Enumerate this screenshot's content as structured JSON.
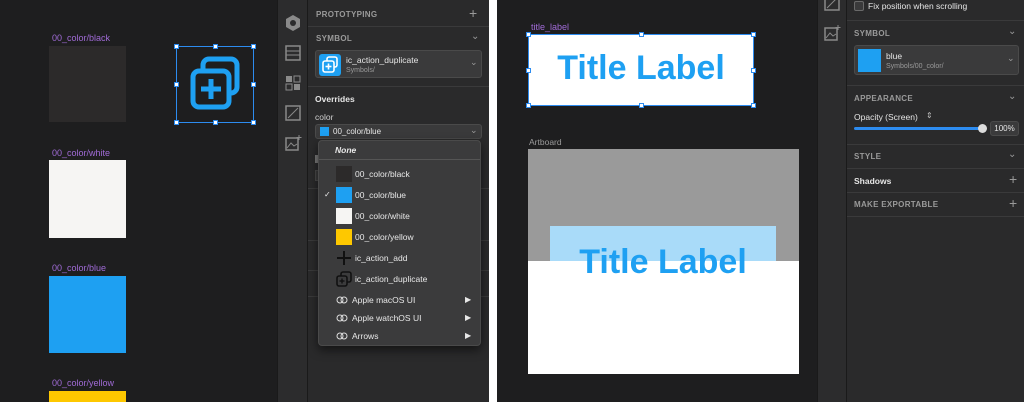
{
  "colors": {
    "blue": "#1ea0f2",
    "black": "#2c2a2a",
    "white": "#f6f5f3",
    "yellow": "#fec800",
    "selection": "#2d8cf0",
    "symbol_label": "#a06bd6"
  },
  "left_canvas": {
    "symbols": [
      {
        "label": "00_color/black"
      },
      {
        "label": "00_color/white"
      },
      {
        "label": "00_color/blue"
      },
      {
        "label": "00_color/yellow"
      }
    ],
    "icon_name": "duplicate-icon"
  },
  "inspector": {
    "prototyping": "PROTOTYPING",
    "symbol_header": "SYMBOL",
    "symbol_name": "ic_action_duplicate",
    "symbol_path": "Symbols/",
    "overrides": "Overrides",
    "color_label": "color",
    "color_value": "00_color/blue"
  },
  "dropdown": {
    "none": "None",
    "items": [
      {
        "label": "00_color/black",
        "swatch": "#2c2a2a",
        "checked": false
      },
      {
        "label": "00_color/blue",
        "swatch": "#1ea0f2",
        "checked": true
      },
      {
        "label": "00_color/white",
        "swatch": "#f6f5f3",
        "checked": false
      },
      {
        "label": "00_color/yellow",
        "swatch": "#fec800",
        "checked": false
      },
      {
        "label": "ic_action_add",
        "icon": "plus-icon"
      },
      {
        "label": "ic_action_duplicate",
        "icon": "duplicate-icon"
      },
      {
        "label": "Apple macOS UI",
        "icon": "link-icon",
        "submenu": true
      },
      {
        "label": "Apple watchOS UI",
        "icon": "link-icon",
        "submenu": true
      },
      {
        "label": "Arrows",
        "icon": "link-icon",
        "submenu": true
      }
    ]
  },
  "right_canvas": {
    "title_label_name": "title_label",
    "title_label_text": "Title Label",
    "artboard_label": "Artboard",
    "artboard_title": "Title Label"
  },
  "right_inspector": {
    "fix_position": "Fix position when scrolling",
    "symbol_header": "SYMBOL",
    "symbol_name": "blue",
    "symbol_path": "Symbols/00_color/",
    "appearance": "APPEARANCE",
    "opacity_label": "Opacity (Screen)",
    "opacity_value": "100%",
    "opacity_level": 1.0,
    "style": "STYLE",
    "shadows": "Shadows",
    "make_exportable": "MAKE EXPORTABLE"
  }
}
